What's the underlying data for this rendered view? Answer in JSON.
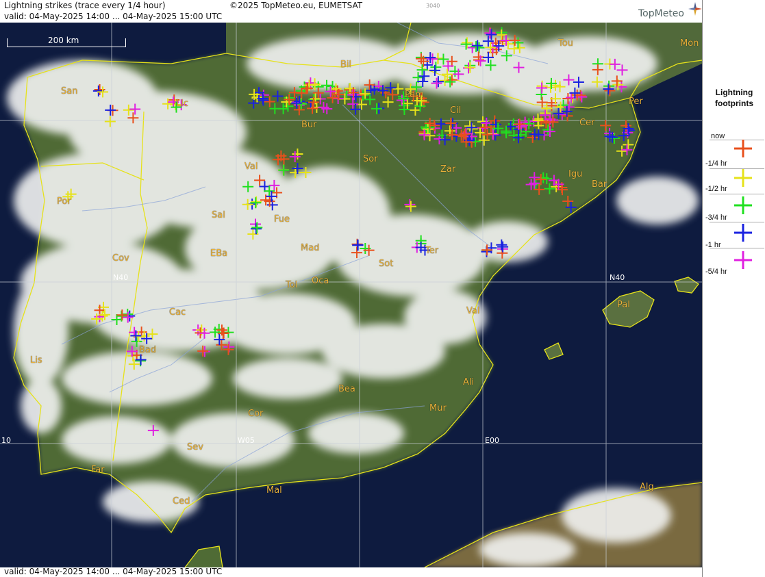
{
  "header": {
    "title": "Lightning strikes (trace every 1/4 hour)",
    "copyright": "©2025 TopMeteo.eu, EUMETSAT",
    "code": "3040",
    "valid": "valid:  04-May-2025 14:00 ... 04-May-2025 15:00 UTC",
    "logo": "TopMeteo"
  },
  "footer": {
    "valid": "valid:  04-May-2025 14:00 ... 04-May-2025 15:00 UTC"
  },
  "map": {
    "scale_label": "200 km",
    "grid_labels": [
      "N40",
      "N40",
      "W05",
      "E00",
      "10"
    ],
    "cities": [
      "Bil",
      "Tou",
      "Mon",
      "San",
      "Llc",
      "Bur",
      "Pam",
      "Cil",
      "Per",
      "Cer",
      "Val",
      "Sor",
      "Zar",
      "Igu",
      "Bar",
      "Por",
      "Sal",
      "Fue",
      "Mad",
      "EBa",
      "Cov",
      "Sot",
      "Ter",
      "Tol",
      "Oca",
      "Cac",
      "Val",
      "Pal",
      "Bad",
      "Lis",
      "Bea",
      "Ali",
      "Mur",
      "Cor",
      "Sev",
      "Far",
      "Mal",
      "Ced",
      "Alg"
    ]
  },
  "legend": {
    "title_line1": "Lightning",
    "title_line2": "footprints",
    "items": [
      {
        "label": "now",
        "color": null
      },
      {
        "label": "-1/4 hr",
        "color": "#e8501c"
      },
      {
        "label": "-1/2 hr",
        "color": "#e6e21a"
      },
      {
        "label": "-3/4 hr",
        "color": "#20e020"
      },
      {
        "label": "-1 hr",
        "color": "#1a22e0"
      },
      {
        "label": "-5/4 hr",
        "color": "#e020e0"
      }
    ]
  },
  "colors": {
    "sea": "#0e1b3f",
    "land": "#4f6b35",
    "cloud": "#f2f3f2",
    "coastline": "#e6e21a",
    "city": "#e8b13a"
  }
}
